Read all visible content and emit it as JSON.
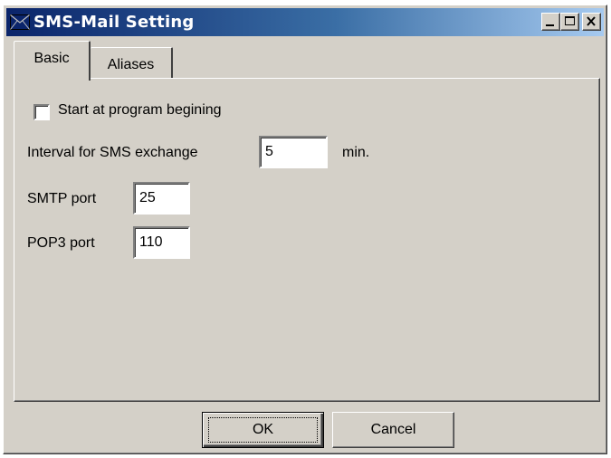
{
  "window": {
    "title": "SMS-Mail Setting",
    "title_icon": "envelope-icon",
    "caption_buttons": [
      "minimize-icon",
      "maximize-icon",
      "close-icon"
    ]
  },
  "tabs": [
    {
      "label": "Basic",
      "selected": true
    },
    {
      "label": "Aliases",
      "selected": false
    }
  ],
  "basic": {
    "start_checkbox_label": "Start at program begining",
    "start_checked": false,
    "interval_label": "Interval for SMS exchange",
    "interval_value": "5",
    "interval_unit": "min.",
    "smtp_label": "SMTP port",
    "smtp_value": "25",
    "pop3_label": "POP3 port",
    "pop3_value": "110"
  },
  "buttons": {
    "ok": "OK",
    "cancel": "Cancel"
  },
  "colors": {
    "face": "#d4d0c8",
    "title_start": "#0a246a",
    "title_end": "#a6caf0"
  }
}
